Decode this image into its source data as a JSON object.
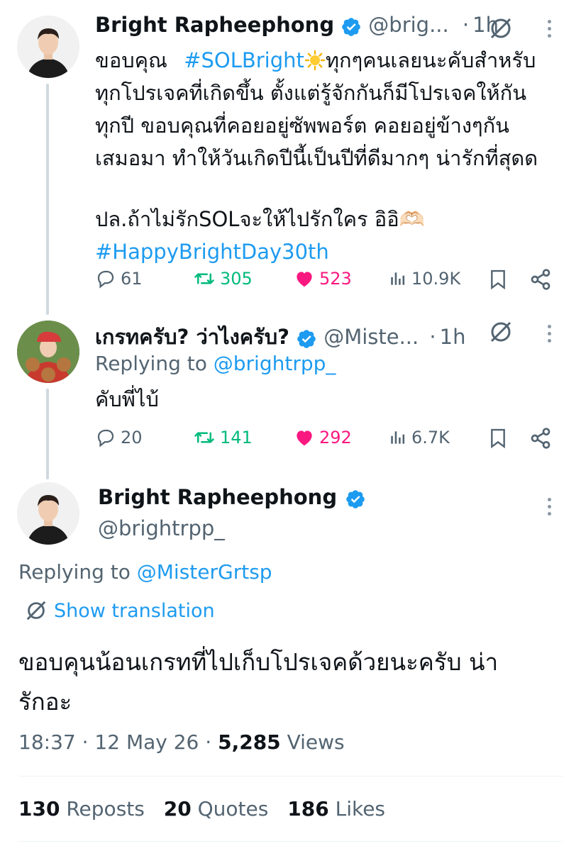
{
  "tweet1": {
    "author_name": "Bright Rapheephong",
    "handle": "@brig...",
    "time": "1h",
    "lines": [
      "ขอบคุณ",
      "#SOLBright",
      "ทุกๆคนเลยนะคับสำหรับ",
      "ทุกโปรเจคที่เกิดขึ้น ตั้งแต่รู้จักกันก็มีโปรเจคให้กัน",
      "ทุกปี ขอบคุณที่คอยอยู่ซัพพอร์ต คอยอยู่ข้างๆกัน",
      "เสมอมา ทำให้วันเกิดปีนี้เป็นปีที่ดีมากๆ น่ารักที่สุดด",
      "ปล.ถ้าไม่รักSOLจะให้ไปรักใคร อิอิ🫶🏻",
      "#HappyBrightDay30th"
    ],
    "replies": "61",
    "reposts": "305",
    "likes": "523",
    "views": "10.9K"
  },
  "tweet2": {
    "author_name": "เกรทครับ? ว่าไงครับ?",
    "handle": "@Miste...",
    "time": "1h",
    "replying_prefix": "Replying to",
    "replying_handle": "@brightrpp_",
    "text": "คับพี่ไบ้",
    "replies": "20",
    "reposts": "141",
    "likes": "292",
    "views": "6.7K"
  },
  "main": {
    "author_name": "Bright Rapheephong",
    "handle": "@brightrpp_",
    "replying_prefix": "Replying to",
    "replying_handle": "@MisterGrtsp",
    "show_translation": "Show translation",
    "text_line1": "ขอบคุนน้อนเกรทที่ไปเก็บโปรเจคด้วยนะครับ น่า",
    "text_line2": "รักอะ",
    "time": "18:37",
    "date": "12 May 26",
    "views_count": "5,285",
    "views_label": "Views",
    "reposts_count": "130",
    "reposts_label": "Reposts",
    "quotes_count": "20",
    "quotes_label": "Quotes",
    "likes_count": "186",
    "likes_label": "Likes"
  },
  "colors": {
    "link": "#1d9bf0",
    "repost": "#00ba7c",
    "like": "#f91880",
    "muted": "#536471",
    "verified": "#1d9bf0"
  },
  "icons": [
    "verified-badge-icon",
    "grok-icon",
    "more-icon",
    "reply-icon",
    "repost-icon",
    "like-icon",
    "views-icon",
    "bookmark-icon",
    "share-icon",
    "sun-emoji-icon",
    "translate-icon"
  ]
}
